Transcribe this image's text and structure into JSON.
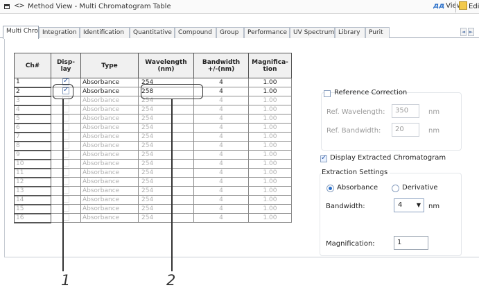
{
  "window": {
    "title": "Method View - Multi Chromatogram Table",
    "nav_arrows": "<>",
    "view_label": "View",
    "edit_label": "Edit"
  },
  "tabs": [
    {
      "label": "Multi Chrom",
      "active": true
    },
    {
      "label": "Integration"
    },
    {
      "label": "Identification"
    },
    {
      "label": "Quantitative"
    },
    {
      "label": "Compound"
    },
    {
      "label": "Group"
    },
    {
      "label": "Performance"
    },
    {
      "label": "UV Spectrum"
    },
    {
      "label": "Library"
    },
    {
      "label": "Purit"
    }
  ],
  "tab_scroll": {
    "left": "◄",
    "right": "►"
  },
  "table": {
    "headers": {
      "ch": "Ch#",
      "display": "Disp-\nlay",
      "type": "Type",
      "wavelength": "Wavelength\n(nm)",
      "bandwidth": "Bandwidth\n+/-(nm)",
      "magnification": "Magnifica-\ntion"
    },
    "rows": [
      {
        "ch": "1",
        "display": true,
        "type": "Absorbance",
        "wavelength": "254",
        "bandwidth": "4",
        "magnification": "1.00",
        "active": true
      },
      {
        "ch": "2",
        "display": true,
        "type": "Absorbance",
        "wavelength": "258",
        "bandwidth": "4",
        "magnification": "1.00",
        "active": true
      },
      {
        "ch": "3",
        "display": false,
        "type": "Absorbance",
        "wavelength": "254",
        "bandwidth": "4",
        "magnification": "1.00",
        "active": false
      },
      {
        "ch": "4",
        "display": false,
        "type": "Absorbance",
        "wavelength": "254",
        "bandwidth": "4",
        "magnification": "1.00",
        "active": false
      },
      {
        "ch": "5",
        "display": false,
        "type": "Absorbance",
        "wavelength": "254",
        "bandwidth": "4",
        "magnification": "1.00",
        "active": false
      },
      {
        "ch": "6",
        "display": false,
        "type": "Absorbance",
        "wavelength": "254",
        "bandwidth": "4",
        "magnification": "1.00",
        "active": false
      },
      {
        "ch": "7",
        "display": false,
        "type": "Absorbance",
        "wavelength": "254",
        "bandwidth": "4",
        "magnification": "1.00",
        "active": false
      },
      {
        "ch": "8",
        "display": false,
        "type": "Absorbance",
        "wavelength": "254",
        "bandwidth": "4",
        "magnification": "1.00",
        "active": false
      },
      {
        "ch": "9",
        "display": false,
        "type": "Absorbance",
        "wavelength": "254",
        "bandwidth": "4",
        "magnification": "1.00",
        "active": false
      },
      {
        "ch": "10",
        "display": false,
        "type": "Absorbance",
        "wavelength": "254",
        "bandwidth": "4",
        "magnification": "1.00",
        "active": false
      },
      {
        "ch": "11",
        "display": false,
        "type": "Absorbance",
        "wavelength": "254",
        "bandwidth": "4",
        "magnification": "1.00",
        "active": false
      },
      {
        "ch": "12",
        "display": false,
        "type": "Absorbance",
        "wavelength": "254",
        "bandwidth": "4",
        "magnification": "1.00",
        "active": false
      },
      {
        "ch": "13",
        "display": false,
        "type": "Absorbance",
        "wavelength": "254",
        "bandwidth": "4",
        "magnification": "1.00",
        "active": false
      },
      {
        "ch": "14",
        "display": false,
        "type": "Absorbance",
        "wavelength": "254",
        "bandwidth": "4",
        "magnification": "1.00",
        "active": false
      },
      {
        "ch": "15",
        "display": false,
        "type": "Absorbance",
        "wavelength": "254",
        "bandwidth": "4",
        "magnification": "1.00",
        "active": false
      },
      {
        "ch": "16",
        "display": false,
        "type": "Absorbance",
        "wavelength": "254",
        "bandwidth": "4",
        "magnification": "1.00",
        "active": false
      }
    ]
  },
  "reference": {
    "checkbox_label": "Reference Correction",
    "checked": false,
    "wavelength_label": "Ref. Wavelength:",
    "wavelength_value": "350",
    "wavelength_unit": "nm",
    "bandwidth_label": "Ref. Bandwidth:",
    "bandwidth_value": "20",
    "bandwidth_unit": "nm"
  },
  "extraction": {
    "display_checkbox_label": "Display Extracted Chromatogram",
    "display_checked": true,
    "group_title": "Extraction Settings",
    "absorbance_label": "Absorbance",
    "absorbance_selected": true,
    "derivative_label": "Derivative",
    "bandwidth_label": "Bandwidth:",
    "bandwidth_value": "4",
    "bandwidth_unit": "nm",
    "magnification_label": "Magnification:",
    "magnification_value": "1"
  },
  "callouts": [
    "1",
    "2"
  ]
}
